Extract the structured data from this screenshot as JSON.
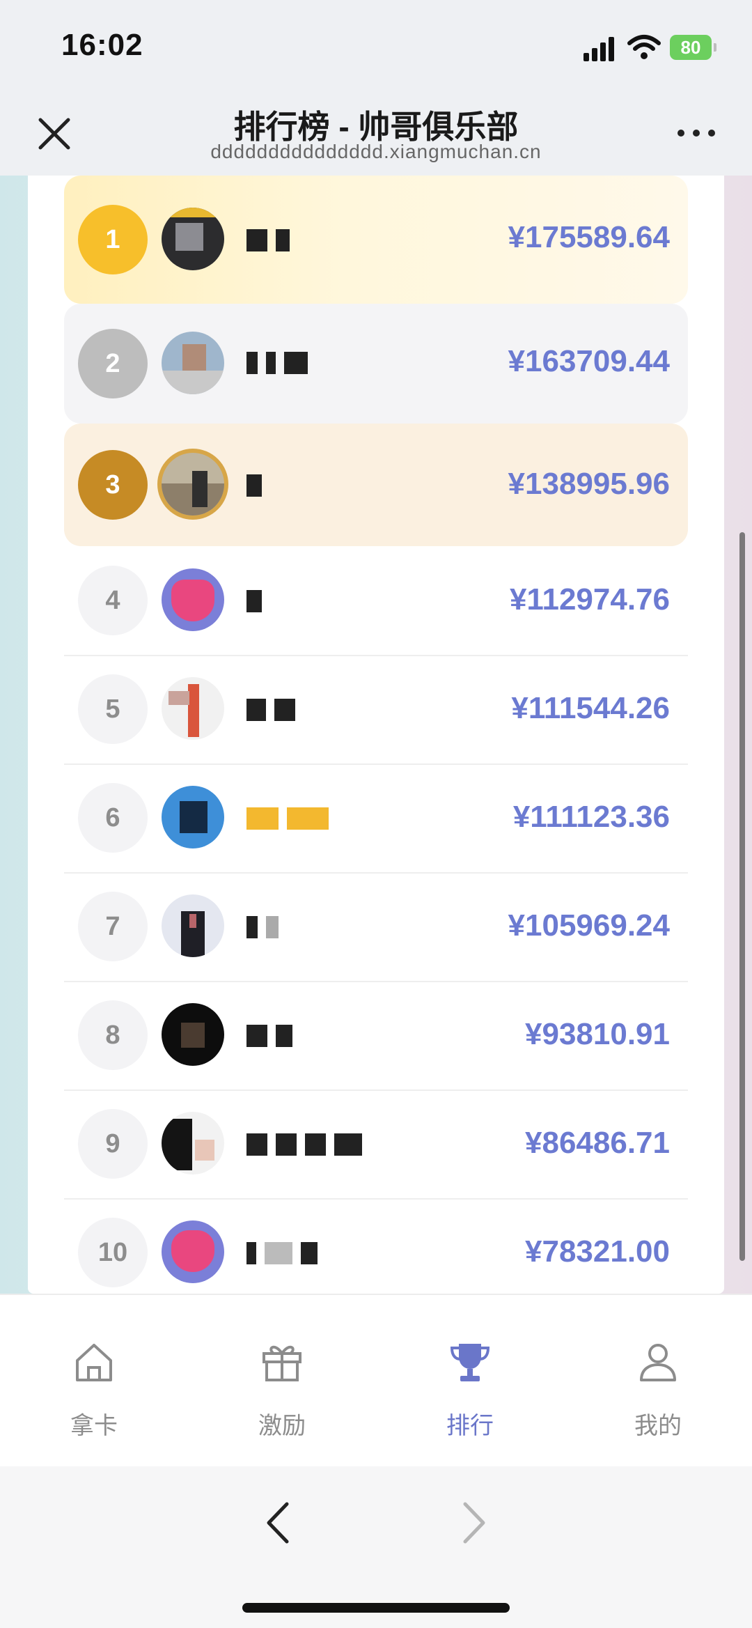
{
  "status": {
    "time": "16:02",
    "battery": "80"
  },
  "header": {
    "title": "排行榜 - 帅哥俱乐部",
    "url": "ddddddddddddddd.xiangmuchan.cn"
  },
  "colors": {
    "accent": "#6a76c9",
    "amount": "#6b7ad1",
    "gold": "#f7bf2b",
    "silver": "#bdbdbd",
    "bronze": "#c68b25"
  },
  "leaderboard": [
    {
      "rank": "1",
      "amount": "¥175589.64"
    },
    {
      "rank": "2",
      "amount": "¥163709.44"
    },
    {
      "rank": "3",
      "amount": "¥138995.96"
    },
    {
      "rank": "4",
      "amount": "¥112974.76"
    },
    {
      "rank": "5",
      "amount": "¥111544.26"
    },
    {
      "rank": "6",
      "amount": "¥111123.36"
    },
    {
      "rank": "7",
      "amount": "¥105969.24"
    },
    {
      "rank": "8",
      "amount": "¥93810.91"
    },
    {
      "rank": "9",
      "amount": "¥86486.71"
    },
    {
      "rank": "10",
      "amount": "¥78321.00"
    }
  ],
  "tabs": [
    {
      "label": "拿卡",
      "icon": "home-icon"
    },
    {
      "label": "激励",
      "icon": "gift-icon"
    },
    {
      "label": "排行",
      "icon": "trophy-icon",
      "active": true
    },
    {
      "label": "我的",
      "icon": "user-icon"
    }
  ]
}
